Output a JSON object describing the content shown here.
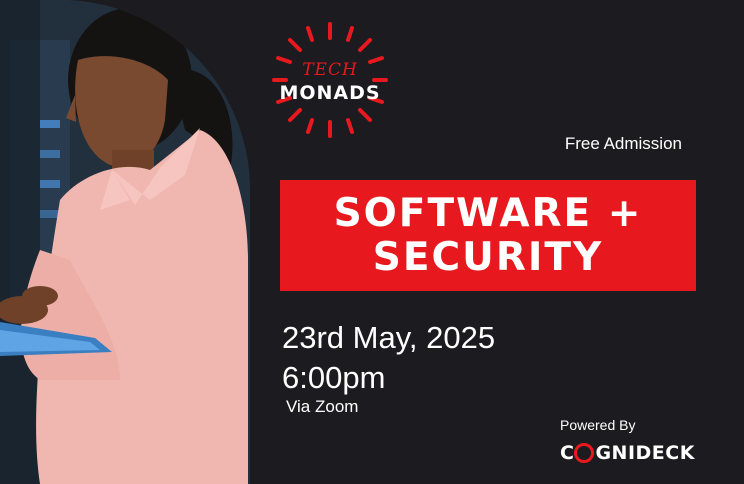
{
  "logo": {
    "line1": "TECH",
    "line2": "MONADS",
    "icon": "sunburst-icon"
  },
  "event": {
    "admission": "Free Admission",
    "title_line1": "SOFTWARE +",
    "title_line2": "SECURITY",
    "date": "23rd May, 2025",
    "time": "6:00pm",
    "venue": "Via Zoom"
  },
  "sponsor": {
    "powered_by": "Powered By",
    "brand_first": "C",
    "brand_rest": "GNIDECK"
  },
  "colors": {
    "background": "#1c1b1f",
    "accent_red": "#e8191e",
    "text": "#ffffff"
  }
}
